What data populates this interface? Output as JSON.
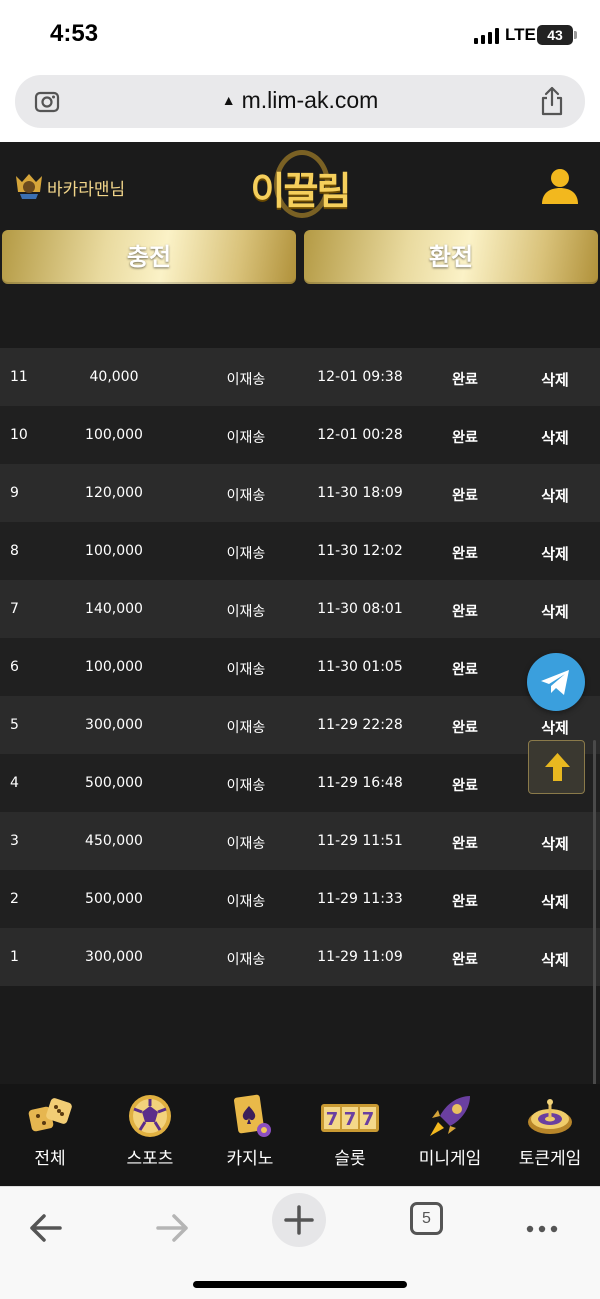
{
  "status_bar": {
    "time": "4:53",
    "network": "LTE",
    "battery": "43"
  },
  "browser": {
    "url": "m.lim-ak.com",
    "tab_count": "5"
  },
  "header": {
    "user_name": "바카라맨님",
    "logo_text": "이끌림"
  },
  "buttons": {
    "deposit": "충전",
    "withdraw": "환전"
  },
  "rows": [
    {
      "no": "11",
      "amount": "40,000",
      "name": "이재송",
      "date": "12-01 09:38",
      "status": "완료",
      "action": "삭제"
    },
    {
      "no": "10",
      "amount": "100,000",
      "name": "이재송",
      "date": "12-01 00:28",
      "status": "완료",
      "action": "삭제"
    },
    {
      "no": "9",
      "amount": "120,000",
      "name": "이재송",
      "date": "11-30 18:09",
      "status": "완료",
      "action": "삭제"
    },
    {
      "no": "8",
      "amount": "100,000",
      "name": "이재송",
      "date": "11-30 12:02",
      "status": "완료",
      "action": "삭제"
    },
    {
      "no": "7",
      "amount": "140,000",
      "name": "이재송",
      "date": "11-30 08:01",
      "status": "완료",
      "action": "삭제"
    },
    {
      "no": "6",
      "amount": "100,000",
      "name": "이재송",
      "date": "11-30 01:05",
      "status": "완료",
      "action": ""
    },
    {
      "no": "5",
      "amount": "300,000",
      "name": "이재송",
      "date": "11-29 22:28",
      "status": "완료",
      "action": "삭제"
    },
    {
      "no": "4",
      "amount": "500,000",
      "name": "이재송",
      "date": "11-29 16:48",
      "status": "완료",
      "action": ""
    },
    {
      "no": "3",
      "amount": "450,000",
      "name": "이재송",
      "date": "11-29 11:51",
      "status": "완료",
      "action": "삭제"
    },
    {
      "no": "2",
      "amount": "500,000",
      "name": "이재송",
      "date": "11-29 11:33",
      "status": "완료",
      "action": "삭제"
    },
    {
      "no": "1",
      "amount": "300,000",
      "name": "이재송",
      "date": "11-29 11:09",
      "status": "완료",
      "action": "삭제"
    }
  ],
  "game_nav": [
    {
      "label": "전체",
      "icon": "dice-icon"
    },
    {
      "label": "스포츠",
      "icon": "soccer-ball-icon"
    },
    {
      "label": "카지노",
      "icon": "cards-icon"
    },
    {
      "label": "슬롯",
      "icon": "slot-777-icon"
    },
    {
      "label": "미니게임",
      "icon": "rocket-icon"
    },
    {
      "label": "토큰게임",
      "icon": "roulette-icon"
    }
  ],
  "colors": {
    "gold": "#f1d58a",
    "telegram": "#3a9fdd",
    "background": "#1b1b1b"
  }
}
